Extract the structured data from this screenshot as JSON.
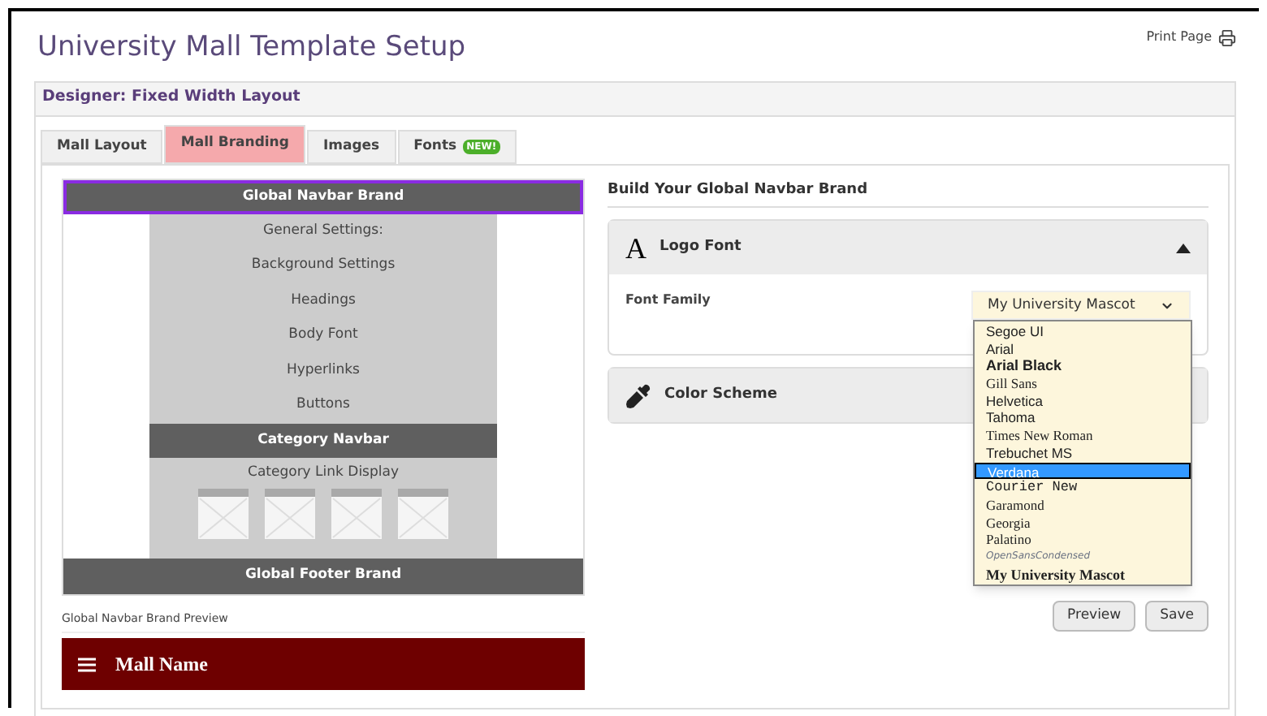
{
  "page_title": "University Mall Template Setup",
  "print_link": "Print Page",
  "panel_title": "Designer: Fixed Width Layout",
  "tabs": [
    {
      "label": "Mall Layout",
      "selected": false
    },
    {
      "label": "Mall Branding",
      "selected": true
    },
    {
      "label": "Images",
      "selected": false
    },
    {
      "label": "Fonts",
      "selected": false,
      "badge": "NEW!"
    }
  ],
  "diagram": {
    "top_bar": {
      "label": "Global Navbar Brand",
      "selected": true
    },
    "settings": [
      "General Settings:",
      "Background Settings",
      "Headings",
      "Body Font",
      "Hyperlinks",
      "Buttons"
    ],
    "category_bar": "Category Navbar",
    "category_caption": "Category Link Display",
    "footer_bar": "Global Footer Brand"
  },
  "preview": {
    "label": "Global Navbar Brand Preview",
    "mall_name": "Mall Name"
  },
  "builder": {
    "heading": "Build Your Global Navbar Brand",
    "sections": [
      {
        "title": "Logo Font",
        "kind": "font",
        "icon": "A",
        "expanded": true
      },
      {
        "title": "Color Scheme",
        "kind": "color",
        "expanded": false
      }
    ],
    "field_label": "Font Family",
    "select_value": "My University Mascot",
    "options": [
      {
        "label": "Segoe UI",
        "kind": "sans",
        "selected": false
      },
      {
        "label": "Arial",
        "kind": "sans",
        "selected": false
      },
      {
        "label": "Arial Black",
        "kind": "heavy",
        "selected": false
      },
      {
        "label": "Gill Sans",
        "kind": "serif",
        "selected": false
      },
      {
        "label": "Helvetica",
        "kind": "sans",
        "selected": false
      },
      {
        "label": "Tahoma",
        "kind": "sans",
        "selected": false
      },
      {
        "label": "Times New Roman",
        "kind": "serif",
        "selected": false
      },
      {
        "label": "Trebuchet MS",
        "kind": "sans",
        "selected": false
      },
      {
        "label": "Verdana",
        "kind": "sans",
        "selected": true
      },
      {
        "label": "Courier New",
        "kind": "mono",
        "selected": false
      },
      {
        "label": "Garamond",
        "kind": "serif",
        "selected": false
      },
      {
        "label": "Georgia",
        "kind": "serif",
        "selected": false
      },
      {
        "label": "Palatino",
        "kind": "serif",
        "selected": false
      },
      {
        "label": "OpenSansCondensed",
        "kind": "condensed",
        "selected": false
      },
      {
        "label": "My University Mascot",
        "kind": "serifbold",
        "selected": false
      }
    ],
    "buttons": [
      "Preview",
      "Save"
    ]
  }
}
